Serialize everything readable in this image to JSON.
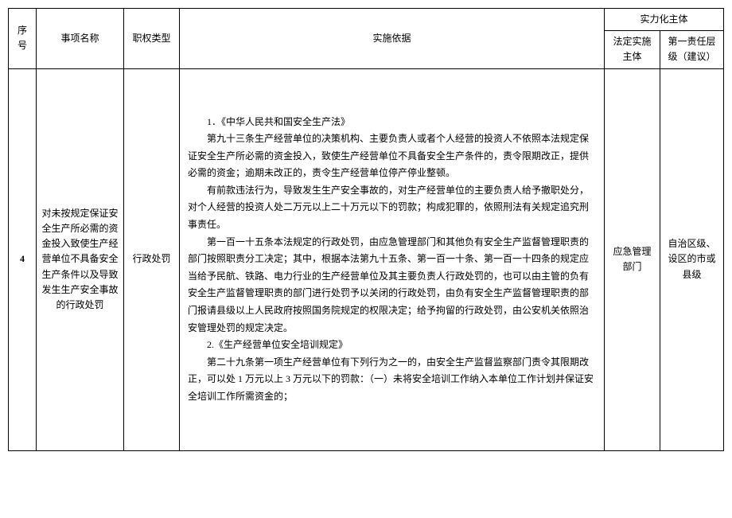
{
  "headers": {
    "seq": "序号",
    "name": "事项名称",
    "type": "职权类型",
    "basis": "实施依据",
    "entity_group": "实力化主体",
    "legal_body": "法定实施主体",
    "level": "第一责任层级（建议）"
  },
  "row": {
    "seq": "4",
    "name": "对未按规定保证安全生产所必需的资金投入致使生产经营单位不具备安全生产条件以及导致发生生产安全事故的行政处罚",
    "type": "行政处罚",
    "basis_p1": "1．《中华人民共和国安全生产法》",
    "basis_p2": "第九十三条生产经营单位的决策机构、主要负责人或者个人经营的投资人不依照本法规定保证安全生产所必需的资金投入，致使生产经营单位不具备安全生产条件的，责令限期改正，提供必需的资金；逾期未改正的，责令生产经营单位停产停业整顿。",
    "basis_p3": "有前款违法行为，导致发生生产安全事故的，对生产经营单位的主要负责人给予撤职处分，对个人经营的投资人处二万元以上二十万元以下的罚款；构成犯罪的，依照刑法有关规定追究刑事责任。",
    "basis_p4": "第一百一十五条本法规定的行政处罚，由应急管理部门和其他负有安全生产监督管理职责的部门按照职责分工决定；其中，根据本法第九十五条、第一百一十条、第一百一十四条的规定应当给予民航、铁路、电力行业的生产经营单位及其主要负责人行政处罚的，也可以由主管的负有安全生产监督管理职责的部门进行处罚予以关闭的行政处罚，由负有安全生产监督管理职责的部门报请县级以上人民政府按照国务院规定的权限决定；给予拘留的行政处罚，由公安机关依照治安管理处罚的规定决定。",
    "basis_p5": "2.《生产经营单位安全培训规定》",
    "basis_p6": "第二十九条第一项生产经营单位有下列行为之一的，由安全生产监督监察部门责令其限期改正，可以处 1 万元以上 3 万元以下的罚款：（一）未将安全培训工作纳入本单位工作计划并保证安全培训工作所需资金的；",
    "legal_body": "应急管理部门",
    "level": "自治区级、设区的市或县级"
  }
}
